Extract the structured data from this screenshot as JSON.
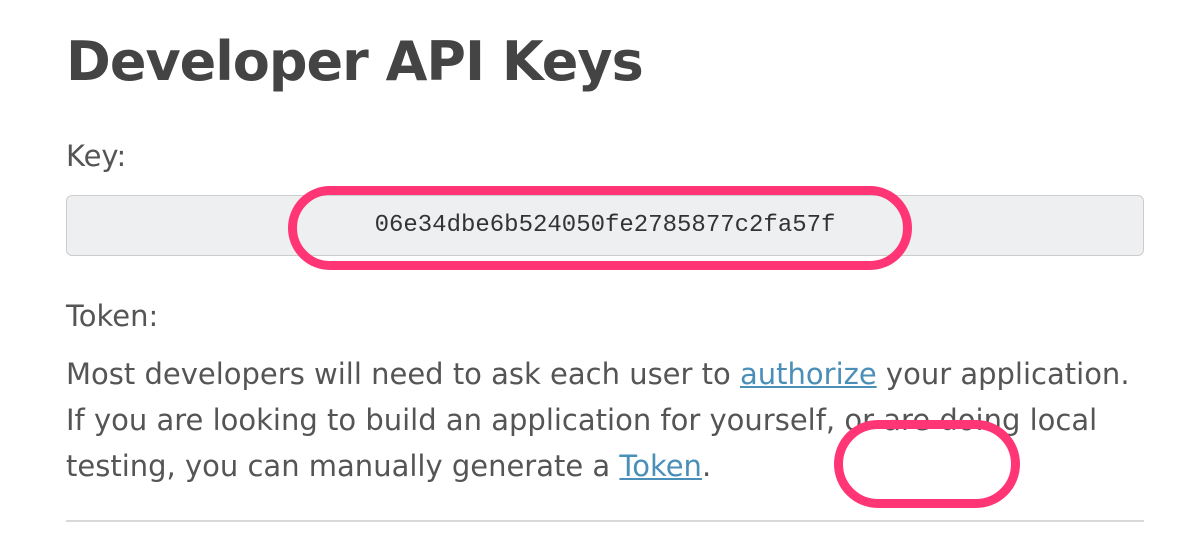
{
  "page": {
    "title": "Developer API Keys"
  },
  "key_section": {
    "label": "Key:",
    "value": "06e34dbe6b524050fe2785877c2fa57f"
  },
  "token_section": {
    "label": "Token:",
    "description_part1": "Most developers will need to ask each user to ",
    "authorize_link": "authorize",
    "description_part2": " your application. If you are looking to build an application for yourself, or are doing local testing, you can manually generate a ",
    "token_link": "Token",
    "description_end": "."
  },
  "colors": {
    "highlight": "#ff3576",
    "link": "#4a8fb8",
    "field_background": "#eeeff1"
  }
}
